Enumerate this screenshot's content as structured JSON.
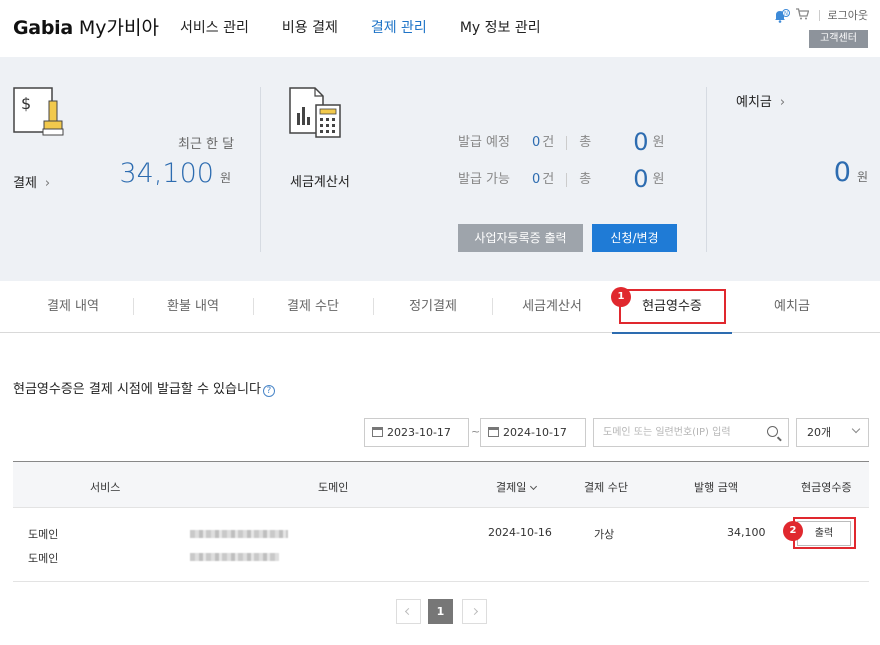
{
  "header": {
    "logo_brand": "Gabia",
    "logo_sub": "My가비아",
    "nav": [
      {
        "label": "서비스 관리",
        "active": false
      },
      {
        "label": "비용 결제",
        "active": false
      },
      {
        "label": "결제 관리",
        "active": true
      },
      {
        "label": "My 정보 관리",
        "active": false
      }
    ],
    "logout_label": "로그아웃",
    "customer_center_label": "고객센터",
    "notification_badge": "N"
  },
  "summary": {
    "payment": {
      "label": "결제",
      "period_label": "최근 한 달",
      "amount": "34,100",
      "unit": "원"
    },
    "tax_invoice": {
      "label": "세금계산서",
      "rows": [
        {
          "label": "발급 예정",
          "count": "0",
          "count_unit": "건",
          "total_label": "총",
          "total": "0",
          "total_unit": "원"
        },
        {
          "label": "발급 가능",
          "count": "0",
          "count_unit": "건",
          "total_label": "총",
          "total": "0",
          "total_unit": "원"
        }
      ],
      "business_cert_button": "사업자등록증 출력",
      "apply_button": "신청/변경"
    },
    "deposit": {
      "label": "예치금",
      "amount": "0",
      "unit": "원"
    }
  },
  "tabs": [
    {
      "label": "결제 내역",
      "active": false
    },
    {
      "label": "환불 내역",
      "active": false
    },
    {
      "label": "결제 수단",
      "active": false
    },
    {
      "label": "정기결제",
      "active": false
    },
    {
      "label": "세금계산서",
      "active": false
    },
    {
      "label": "현금영수증",
      "active": true
    },
    {
      "label": "예치금",
      "active": false
    }
  ],
  "annotations": {
    "tab_marker": "1",
    "print_marker": "2"
  },
  "filters": {
    "notice": "현금영수증은 결제 시점에 발급할 수 있습니다",
    "help_symbol": "?",
    "start_date": "2023-10-17",
    "separator": "~",
    "end_date": "2024-10-17",
    "search_placeholder": "도메인 또는 일련번호(IP) 입력",
    "page_size": "20개"
  },
  "table": {
    "headers": [
      "서비스",
      "도메인",
      "결제일",
      "결제 수단",
      "발행 금액",
      "현금영수증"
    ],
    "rows": [
      {
        "services": [
          "도메인",
          "도메인"
        ],
        "payment_date": "2024-10-16",
        "payment_method": "가상",
        "amount": "34,100",
        "action": "출력"
      }
    ]
  },
  "pagination": {
    "current": "1"
  },
  "colors": {
    "accent_blue": "#2d6cb0",
    "button_blue": "#1f7bd6",
    "annotation_red": "#e0282e",
    "panel_bg": "#eef1f5"
  }
}
